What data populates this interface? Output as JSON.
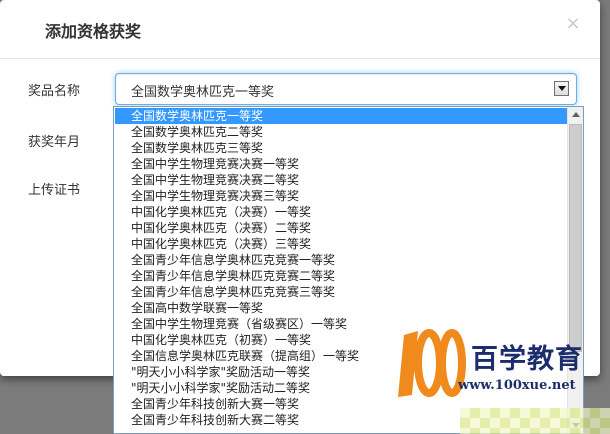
{
  "modal": {
    "title": "添加资格获奖",
    "close_label": "×"
  },
  "form": {
    "award_name_label": "奖品名称",
    "award_date_label": "获奖年月",
    "certificate_label": "上传证书",
    "selected_award": "全国数学奥林匹克一等奖"
  },
  "dropdown": {
    "options": [
      "全国数学奥林匹克一等奖",
      "全国数学奥林匹克二等奖",
      "全国数学奥林匹克三等奖",
      "全国中学生物理竞赛决赛一等奖",
      "全国中学生物理竞赛决赛二等奖",
      "全国中学生物理竞赛决赛三等奖",
      "中国化学奥林匹克（决赛）一等奖",
      "中国化学奥林匹克（决赛）二等奖",
      "中国化学奥林匹克（决赛）三等奖",
      "全国青少年信息学奥林匹克竞赛一等奖",
      "全国青少年信息学奥林匹克竞赛二等奖",
      "全国青少年信息学奥林匹克竞赛三等奖",
      "全国高中数学联赛一等奖",
      "全国中学生物理竞赛（省级赛区）一等奖",
      "中国化学奥林匹克（初赛）一等奖",
      "全国信息学奥林匹克联赛（提高组）一等奖",
      "\"明天小小科学家\"奖励活动一等奖",
      "\"明天小小科学家\"奖励活动二等奖",
      "全国青少年科技创新大赛一等奖",
      "全国青少年科技创新大赛二等奖"
    ],
    "selected_index": 0
  },
  "watermark": {
    "logo_number": "100",
    "brand": "百学教育",
    "url": "www.100xue.net"
  },
  "colors": {
    "selected_bg": "#3399ff",
    "watermark_orange": "#f08a1c",
    "watermark_navy": "#1b2e6b"
  }
}
